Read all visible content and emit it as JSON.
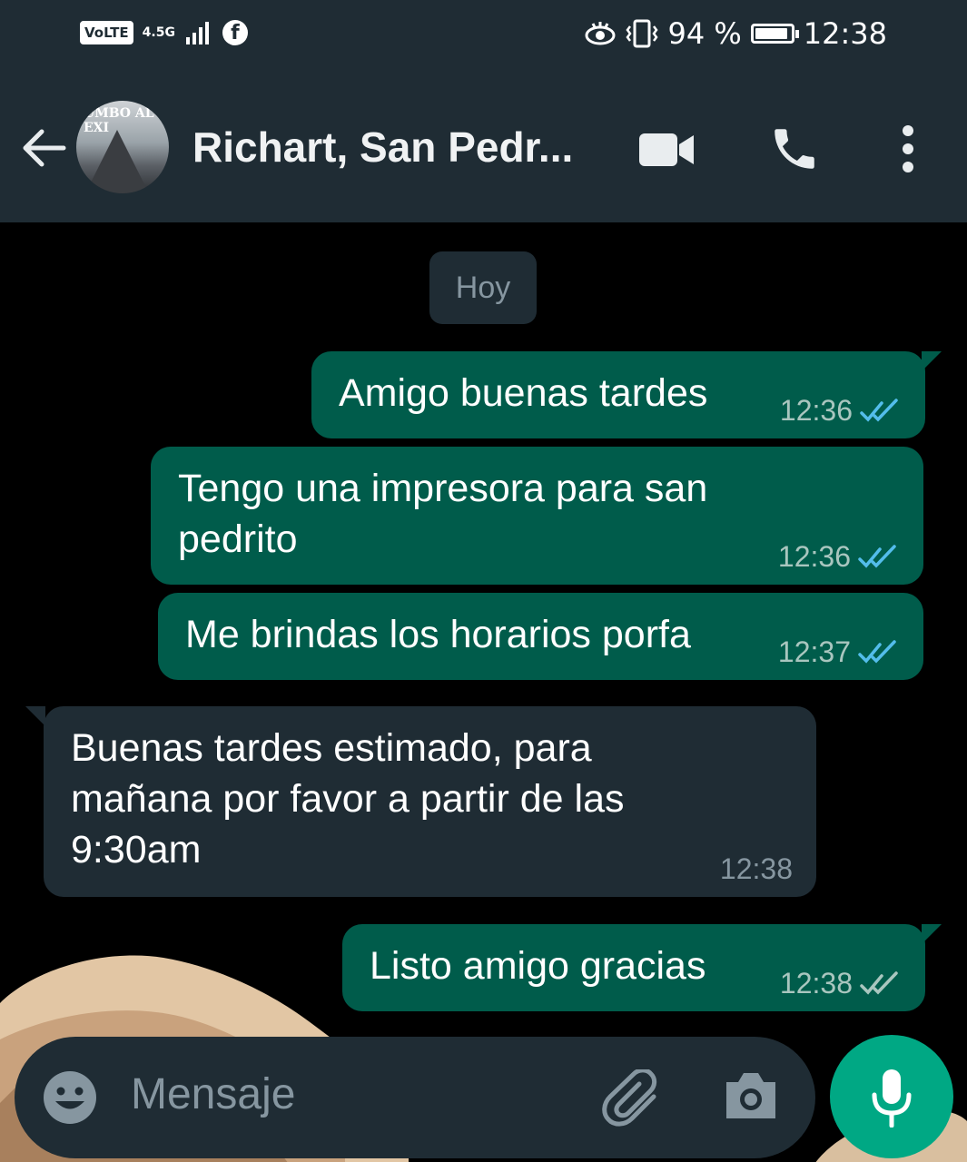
{
  "status_bar": {
    "volte": "VoLTE",
    "network": "4.5G",
    "battery": "94 %",
    "battery_level": 0.94,
    "time": "12:38"
  },
  "header": {
    "avatar_text": "UMBO AL EXI",
    "contact_name": "Richart, San Pedr..."
  },
  "chat": {
    "date_chip": "Hoy",
    "messages": [
      {
        "direction": "out",
        "text": "Amigo buenas tardes",
        "time": "12:36",
        "status": "read"
      },
      {
        "direction": "out",
        "text": "Tengo una impresora para san pedrito",
        "time": "12:36",
        "status": "read"
      },
      {
        "direction": "out",
        "text": "Me brindas los horarios porfa",
        "time": "12:37",
        "status": "read"
      },
      {
        "direction": "in",
        "text": "Buenas tardes estimado, para mañana por favor a partir de las 9:30am",
        "time": "12:38"
      },
      {
        "direction": "out",
        "text": "Listo amigo gracias",
        "time": "12:38",
        "status": "delivered"
      }
    ]
  },
  "composer": {
    "placeholder": "Mensaje"
  },
  "colors": {
    "header_bg": "#1f2c34",
    "outgoing_bubble": "#005c4b",
    "incoming_bubble": "#1f2c34",
    "read_ticks": "#53bdeb",
    "delivered_ticks": "#a9c6bf",
    "mic_button": "#00a884"
  }
}
